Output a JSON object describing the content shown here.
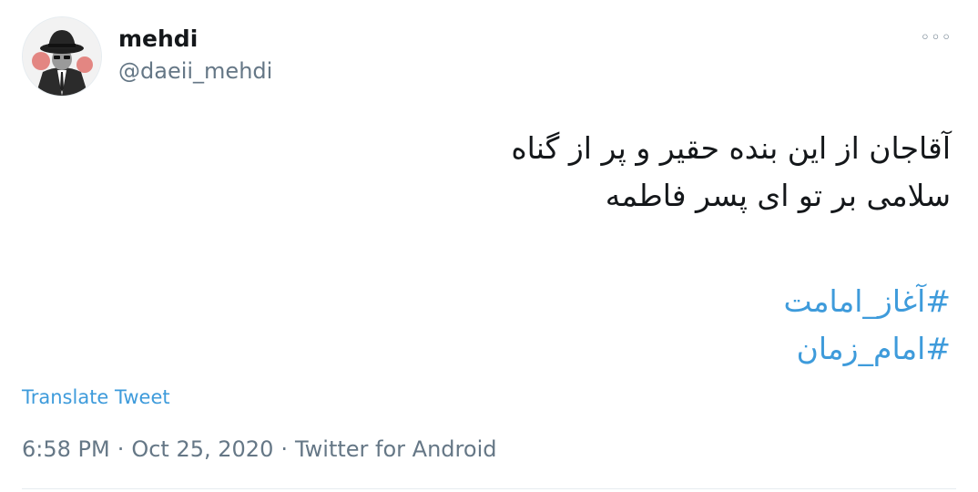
{
  "author": {
    "display_name": "mehdi",
    "handle": "@daeii_mehdi",
    "avatar_icon": "hat-man-avatar-icon"
  },
  "more_icon": "more-icon",
  "tweet": {
    "lines": [
      "آقاجان از این بنده حقیر و پر از گناه",
      "سلامی بر تو ای پسر فاطمه"
    ],
    "hashtags": [
      "#آغاز_امامت",
      "#امام_زمان"
    ]
  },
  "translate_label": "Translate Tweet",
  "meta": {
    "time": "6:58 PM",
    "separator": "·",
    "date": "Oct 25, 2020",
    "source": "Twitter for Android"
  },
  "colors": {
    "link": "#3e9bdb",
    "text": "#14171a",
    "secondary": "#657786"
  }
}
